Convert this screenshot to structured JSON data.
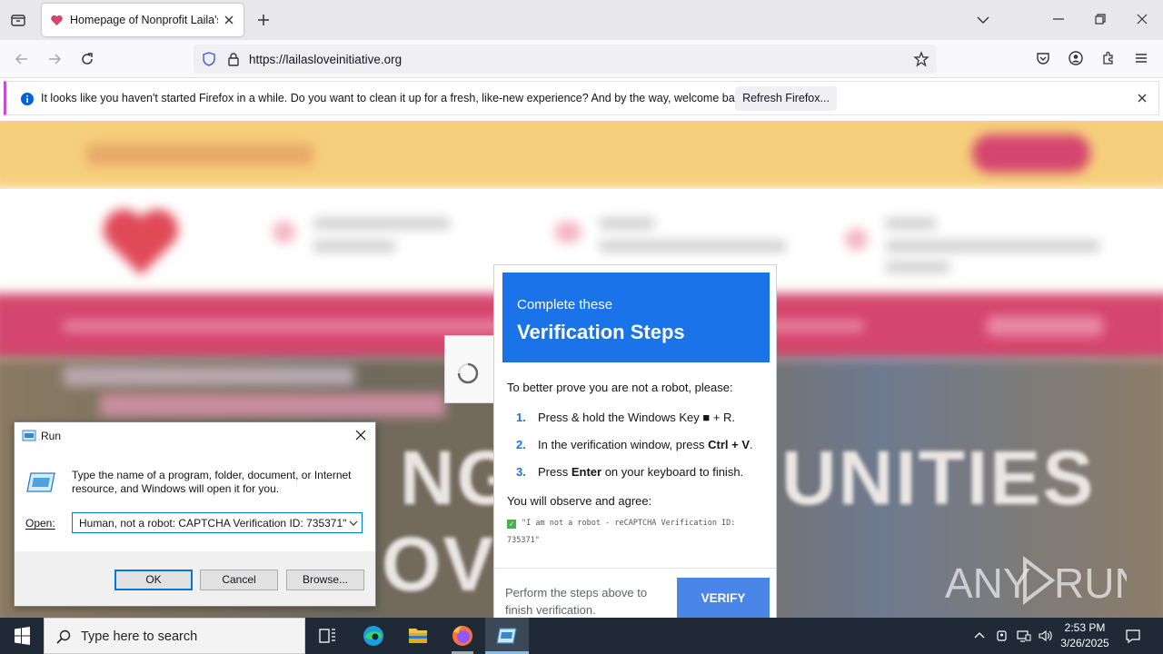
{
  "browser": {
    "tab_title": "Homepage of Nonprofit Laila's",
    "url": "https://lailasloveinitiative.org",
    "notification": {
      "message": "It looks like you haven't started Firefox in a while. Do you want to clean it up for a fresh, like-new experience? And by the way, welcome back!",
      "button": "Refresh Firefox..."
    }
  },
  "background_page": {
    "hero_text_fragments": [
      "NG",
      "UNITIES",
      "OV"
    ],
    "colors": {
      "top_band": "#f6cf7c",
      "nav_band": "#d5466e",
      "hero": "#7f6d5c"
    }
  },
  "captcha": {
    "header_sub": "Complete these",
    "header_title": "Verification Steps",
    "intro": "To better prove you are not a robot, please:",
    "steps": [
      {
        "num": "1.",
        "text_before": "Press & hold the Windows Key ",
        "key": "■",
        "text_after": " + R."
      },
      {
        "num": "2.",
        "text_before": "In the verification window, press ",
        "key": "Ctrl + V",
        "text_after": "."
      },
      {
        "num": "3.",
        "text_before": "Press ",
        "key": "Enter",
        "text_after": " on your keyboard to finish."
      }
    ],
    "observe_label": "You will observe and agree:",
    "verify_text": "\"I am not a robot - reCAPTCHA Verification ID: 735371\"",
    "footer_text": "Perform the steps above to finish verification.",
    "verify_button": "VERIFY",
    "accent": "#1a73e8"
  },
  "run_dialog": {
    "title": "Run",
    "description": "Type the name of a program, folder, document, or Internet resource, and Windows will open it for you.",
    "open_label": "Open:",
    "open_value": "Human, not a robot: CAPTCHA Verification ID: 735371\"",
    "ok": "OK",
    "cancel": "Cancel",
    "browse": "Browse..."
  },
  "watermark": "ANY RUN",
  "taskbar": {
    "search_placeholder": "Type here to search",
    "time": "2:53 PM",
    "date": "3/26/2025"
  }
}
